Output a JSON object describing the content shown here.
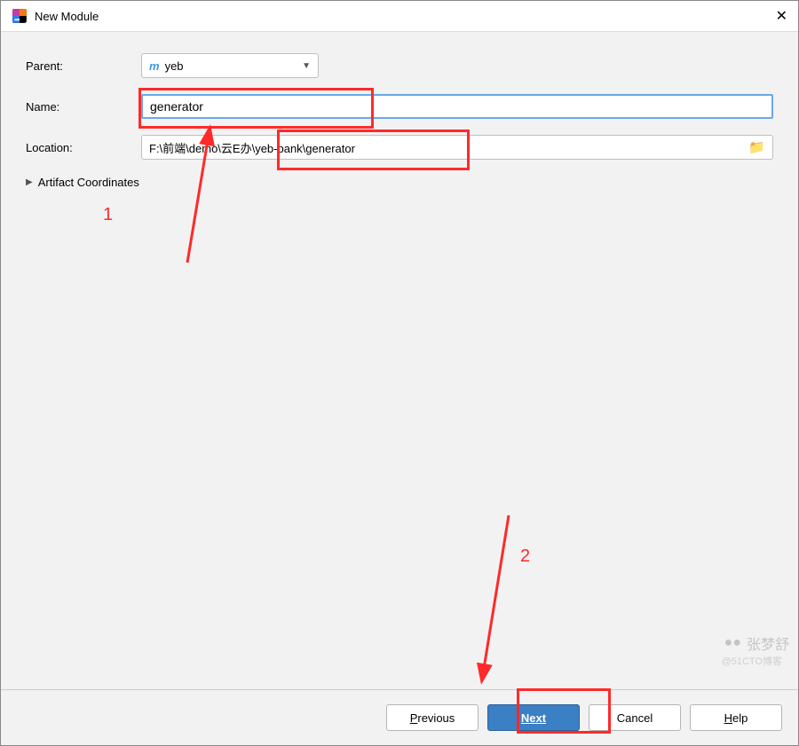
{
  "window": {
    "title": "New Module"
  },
  "form": {
    "parent_label": "Parent:",
    "parent_value": "yeb",
    "name_label": "Name:",
    "name_value": "generator",
    "location_label": "Location:",
    "location_value": "F:\\前端\\demo\\云E办\\yeb-bank\\generator",
    "artifact_label": "Artifact Coordinates"
  },
  "buttons": {
    "previous": "Previous",
    "next": "Next",
    "cancel": "Cancel",
    "help": "Help"
  },
  "annotations": {
    "one": "1",
    "two": "2"
  },
  "watermark": {
    "name": "张梦舒",
    "sub": "@51CTO博客"
  }
}
